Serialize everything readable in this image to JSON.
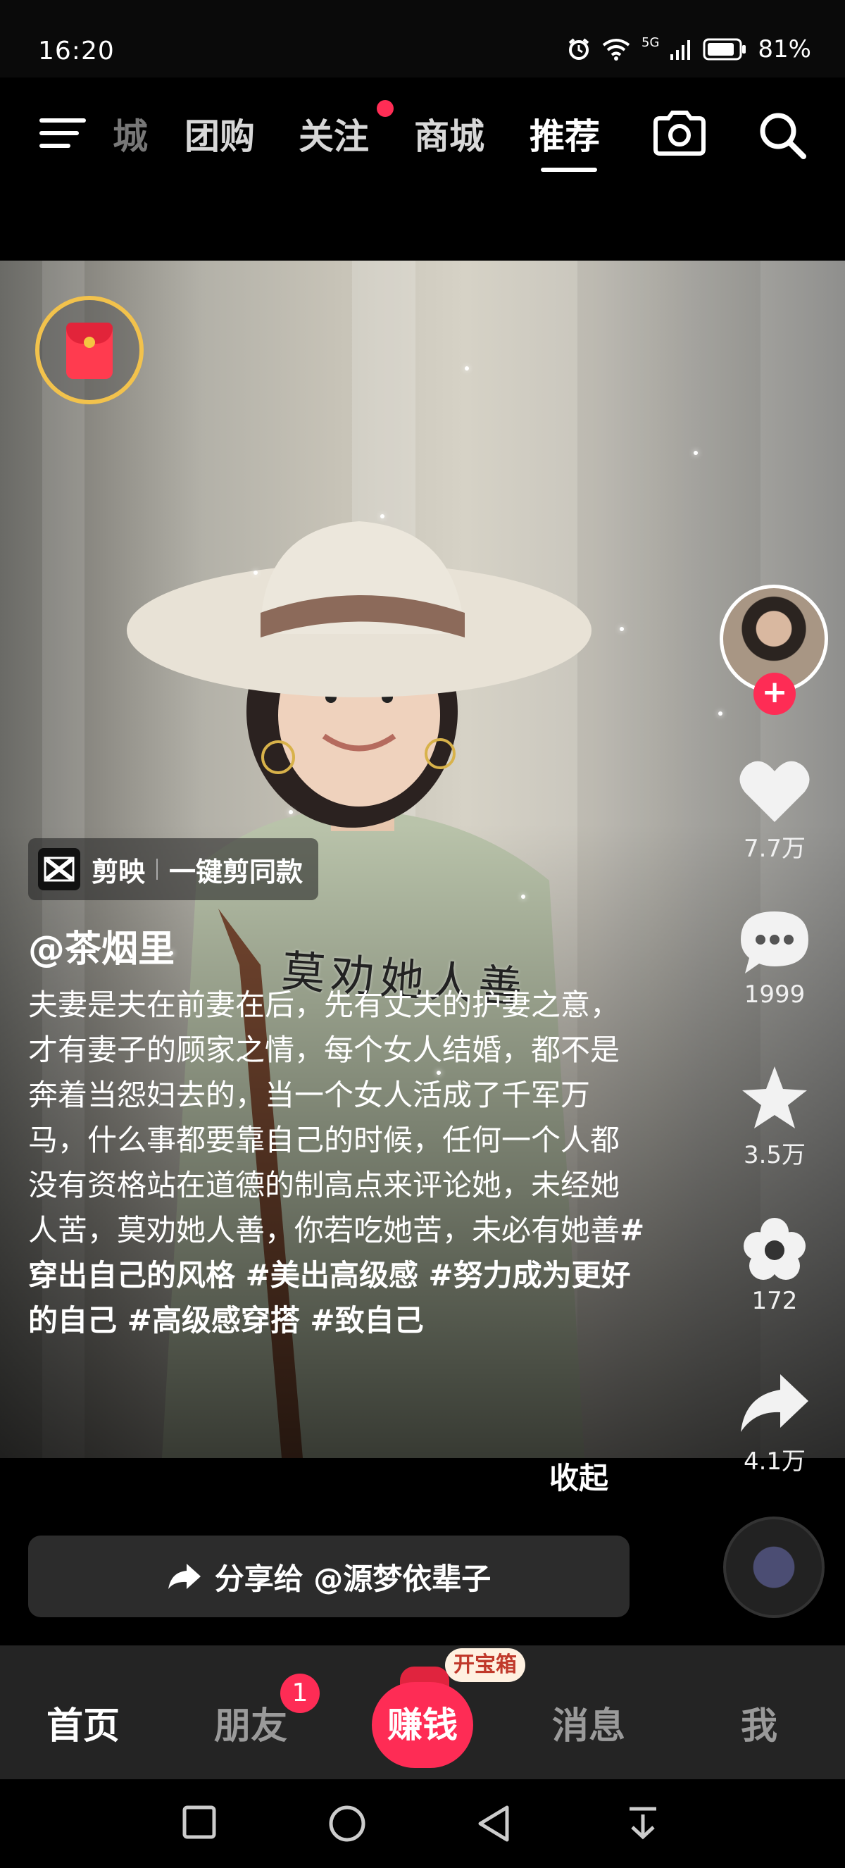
{
  "status_bar": {
    "time": "16:20",
    "network": "5G",
    "battery": "81%"
  },
  "top_nav": {
    "tabs": [
      "城",
      "团购",
      "关注",
      "商城",
      "推荐"
    ],
    "active_tab": "推荐"
  },
  "video": {
    "overlay_text": "莫劝她人善"
  },
  "side": {
    "likes": "7.7万",
    "comments": "1999",
    "favorites": "3.5万",
    "flower": "172",
    "shares": "4.1万"
  },
  "capcut": {
    "app": "剪映",
    "action": "一键剪同款"
  },
  "post": {
    "author": "@茶烟里",
    "description": "夫妻是夫在前妻在后，先有丈夫的护妻之意，才有妻子的顾家之情，每个女人结婚，都不是奔着当怨妇去的，当一个女人活成了千军万马，什么事都要靠自己的时候，任何一个人都没有资格站在道德的制高点来评论她，未经她人苦，莫劝她人善，你若吃她苦，未必有她善",
    "hashtags": "#穿出自己的风格 #美出高级感 #努力成为更好的自己 #高级感穿搭 #致自己",
    "collapse_label": "收起"
  },
  "share_bar": {
    "label": "分享给 @源梦依辈子"
  },
  "bottom_nav": {
    "home": "首页",
    "friends": "朋友",
    "friends_badge": "1",
    "earn": "赚钱",
    "treasure": "开宝箱",
    "messages": "消息",
    "me": "我"
  },
  "colors": {
    "accent": "#fe2c55",
    "bar_bg": "#242424"
  }
}
